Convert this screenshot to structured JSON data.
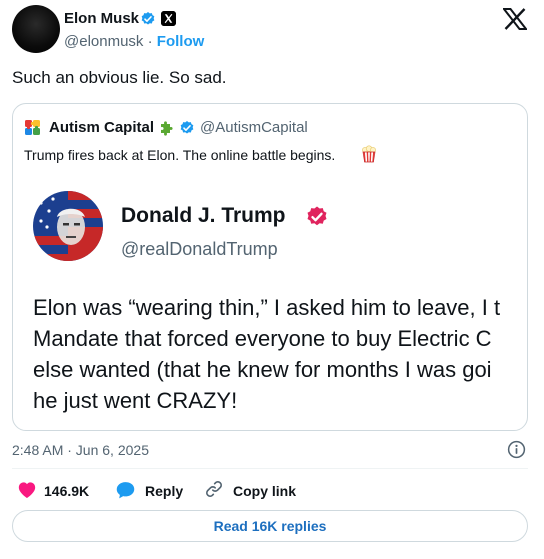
{
  "author": {
    "name": "Elon Musk",
    "handle": "@elonmusk",
    "separator": "·",
    "follow_label": "Follow"
  },
  "tweet": {
    "text": "Such an obvious lie. So sad."
  },
  "quote": {
    "name": "Autism Capital",
    "handle": "@AutismCapital",
    "text": "Trump fires back at Elon. The online battle begins.",
    "embedded": {
      "name": "Donald J. Trump",
      "handle": "@realDonaldTrump",
      "lines": [
        "Elon was “wearing thin,” I asked him to leave, I t",
        "Mandate that forced everyone to buy Electric C",
        "else wanted (that he knew for months I was goi",
        "he just went CRAZY!"
      ]
    }
  },
  "timestamp": "2:48 AM · Jun 6, 2025",
  "actions": {
    "likes": "146.9K",
    "reply": "Reply",
    "copy_link": "Copy link"
  },
  "read_replies": "Read 16K replies",
  "colors": {
    "brand_blue": "#1d9bf0",
    "like_red": "#f91880",
    "trump_badge": "#e0245e",
    "border": "#cfd9de"
  }
}
